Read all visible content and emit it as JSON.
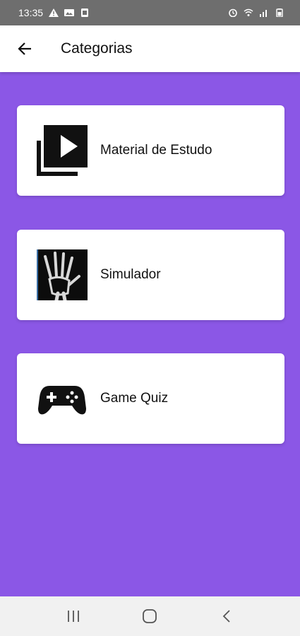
{
  "status_bar": {
    "time": "13:35",
    "left_icons": [
      "warning-icon",
      "photo-icon",
      "notification-icon"
    ],
    "right_icons": [
      "alarm-icon",
      "wifi-icon",
      "signal-icon",
      "battery-icon"
    ]
  },
  "app_bar": {
    "title": "Categorias",
    "back_icon": "arrow-left-icon"
  },
  "colors": {
    "background": "#8B57E6",
    "card": "#FFFFFF",
    "status_bar": "#6E6E6E",
    "nav_bar": "#F1F1F1"
  },
  "categories": [
    {
      "label": "Material de Estudo",
      "icon": "video-library-icon"
    },
    {
      "label": "Simulador",
      "icon": "hand-xray-image"
    },
    {
      "label": "Game Quiz",
      "icon": "gamepad-icon"
    }
  ],
  "nav_bar": {
    "buttons": [
      "recent-apps-icon",
      "home-icon",
      "back-icon"
    ]
  }
}
